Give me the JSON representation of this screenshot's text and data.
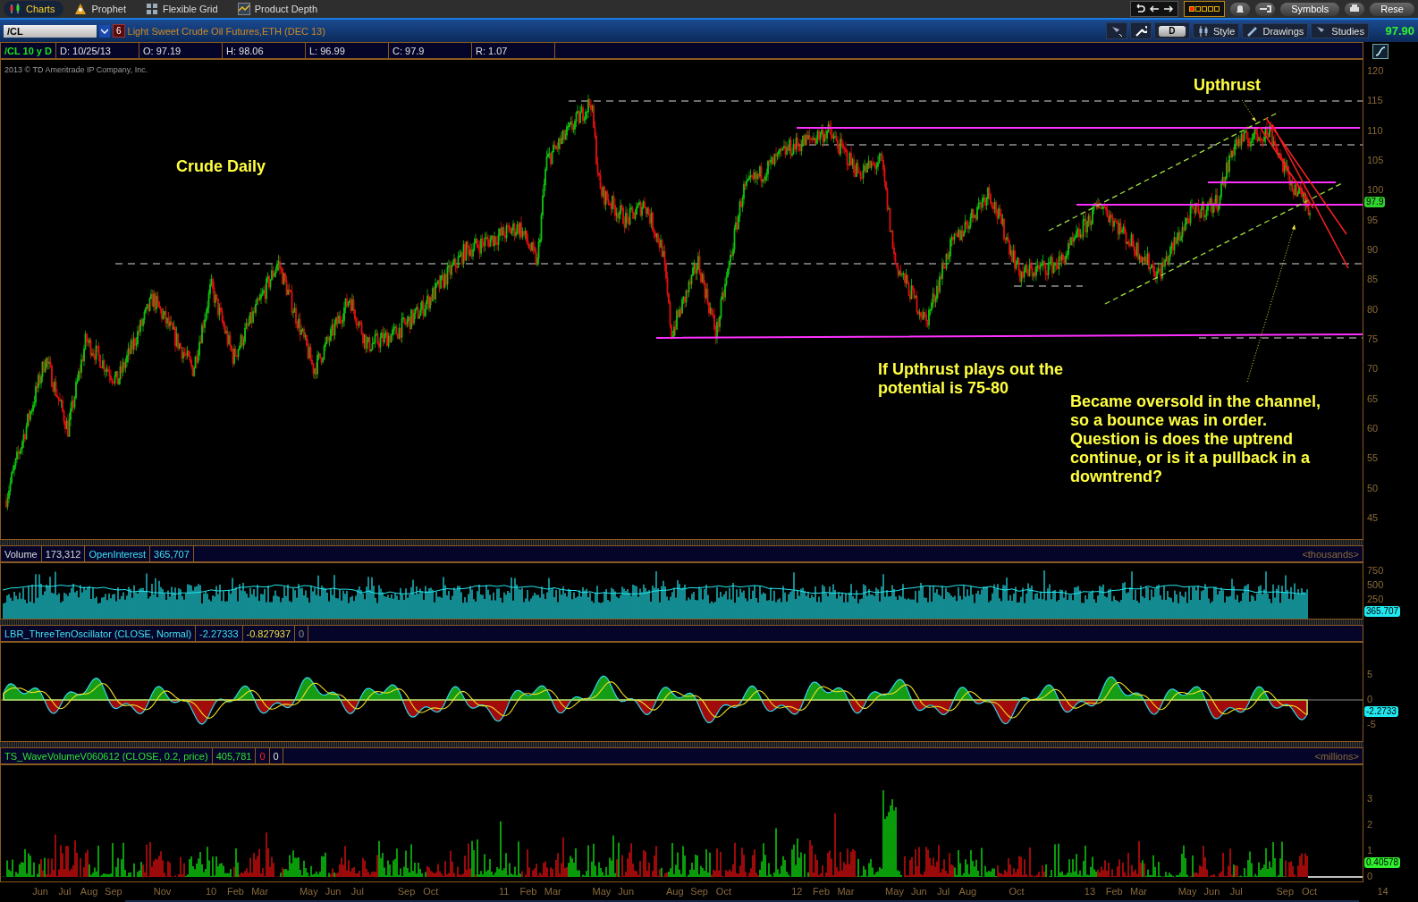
{
  "toolbar": {
    "tabs": [
      {
        "label": "Charts",
        "selected": true
      },
      {
        "label": "Prophet",
        "selected": false
      },
      {
        "label": "Flexible Grid",
        "selected": false
      },
      {
        "label": "Product Depth",
        "selected": false
      }
    ],
    "symbols_button": "Symbols",
    "reset_button": "Rese"
  },
  "chart_header": {
    "symbol": "/CL",
    "count": "6",
    "description": "Light Sweet Crude Oil Futures,ETH (DEC 13)",
    "aggregation": "D",
    "buttons": [
      "Style",
      "Drawings",
      "Studies"
    ],
    "last_price": "97.90"
  },
  "quote": {
    "label": "/CL 10 y D",
    "cells": [
      "D: 10/25/13",
      "O: 97.19",
      "H: 98.06",
      "L: 96.99",
      "C: 97.9",
      "R: 1.07"
    ]
  },
  "price_pane": {
    "copyright": "2013 © TD Ameritrade IP Company, Inc.",
    "annotations": [
      {
        "text": "Crude Daily"
      },
      {
        "text": "Upthrust"
      },
      {
        "text": "If Upthrust plays out the potential is 75-80"
      },
      {
        "text": "Became oversold in the channel, so a bounce was in order. Question is does the uptrend continue, or is it a pullback in a downtrend?"
      }
    ],
    "axis": [
      "120",
      "115",
      "110",
      "105",
      "100",
      "95",
      "90",
      "85",
      "80",
      "75",
      "70",
      "65",
      "60",
      "55",
      "50",
      "45"
    ],
    "price_tag": "97.9"
  },
  "volume_pane": {
    "header": [
      {
        "text": "Volume",
        "kind": "volume"
      },
      {
        "text": "173,312",
        "kind": "volume"
      },
      {
        "text": "OpenInterest",
        "kind": "interest"
      },
      {
        "text": "365,707",
        "kind": "interest"
      }
    ],
    "unit": "<thousands>",
    "axis": [
      "750",
      "500",
      "250"
    ],
    "value_tag": "365.707"
  },
  "oscillator_pane": {
    "header": [
      {
        "text": "LBR_ThreeTenOscillator (CLOSE, Normal)",
        "kind": "oscillator"
      },
      {
        "text": "-2.27333",
        "kind": "oscillator"
      },
      {
        "text": "-0.827937",
        "kind": "signal"
      },
      {
        "text": "0",
        "kind": "zero"
      }
    ],
    "axis": [
      "5",
      "0",
      "-5"
    ],
    "value_tag": "-2.2733"
  },
  "wave_pane": {
    "header": [
      {
        "text": "TS_WaveVolumeV060612 (CLOSE, 0.2, price)",
        "kind": "wave"
      },
      {
        "text": "405,781",
        "kind": "wave"
      },
      {
        "text": "0",
        "kind": "down"
      },
      {
        "text": "0",
        "kind": "neutral"
      }
    ],
    "unit": "<millions>",
    "axis": [
      "3",
      "2",
      "1",
      "0"
    ],
    "value_tag": "0.40578"
  },
  "x_axis": [
    "Jun",
    "Jul",
    "Aug",
    "Sep",
    "Nov",
    "10",
    "Feb",
    "Mar",
    "May",
    "Jun",
    "Jul",
    "Sep",
    "Oct",
    "11",
    "Feb",
    "Mar",
    "May",
    "Jun",
    "Aug",
    "Sep",
    "Oct",
    "12",
    "Feb",
    "Mar",
    "May",
    "Jun",
    "Jul",
    "Aug",
    "Oct",
    "13",
    "Feb",
    "Mar",
    "May",
    "Jun",
    "Jul",
    "Sep",
    "Oct",
    "14"
  ]
}
